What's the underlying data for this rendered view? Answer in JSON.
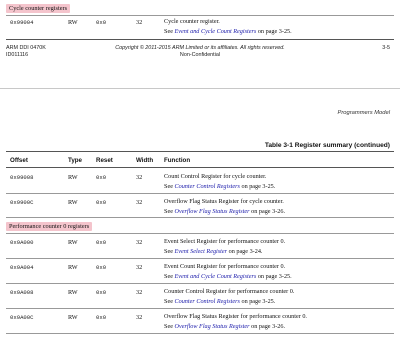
{
  "top_section": {
    "label": "Cycle counter registers",
    "row": {
      "offset": "0x99004",
      "type": "RW",
      "reset": "0x0",
      "width": "32",
      "line1": "Cycle counter register.",
      "see": "See ",
      "link": "Event and Cycle Count Registers",
      "page": " on page 3-25."
    }
  },
  "footer": {
    "doc_id": "ARM DDI 0470K",
    "doc_id2": "ID011116",
    "copyright": "Copyright © 2011-2015 ARM Limited or its affiliates. All rights reserved.",
    "confidential": "Non-Confidential",
    "page_no": "3-5"
  },
  "header": {
    "running_title": "Programmers Model"
  },
  "table": {
    "caption": "Table 3-1 Register summary (continued)",
    "columns": [
      "Offset",
      "Type",
      "Reset",
      "Width",
      "Function"
    ],
    "rows_a": [
      {
        "offset": "0x99008",
        "type": "RW",
        "reset": "0x0",
        "width": "32",
        "line1": "Count Control Register for cycle counter.",
        "see": "See ",
        "link": "Counter Control Registers",
        "page": " on page 3-25."
      },
      {
        "offset": "0x9900C",
        "type": "RW",
        "reset": "0x0",
        "width": "32",
        "line1": "Overflow Flag Status Register for cycle counter.",
        "see": "See ",
        "link": "Overflow Flag Status Register",
        "page": " on page 3-26."
      }
    ],
    "section_label": "Performance counter 0 registers",
    "rows_b": [
      {
        "offset": "0x9A000",
        "type": "RW",
        "reset": "0x0",
        "width": "32",
        "line1": "Event Select Register for performance counter 0.",
        "see": "See ",
        "link": "Event Select Register",
        "page": " on page 3-24."
      },
      {
        "offset": "0x9A004",
        "type": "RW",
        "reset": "0x0",
        "width": "32",
        "line1": "Event Count Register for performance counter 0.",
        "see": "See ",
        "link": "Event and Cycle Count Registers",
        "page": " on page 3-25."
      },
      {
        "offset": "0x9A008",
        "type": "RW",
        "reset": "0x0",
        "width": "32",
        "line1": "Counter Control Register for performance counter 0.",
        "see": "See ",
        "link": "Counter Control Registers",
        "page": " on page 3-25."
      },
      {
        "offset": "0x9A00C",
        "type": "RW",
        "reset": "0x0",
        "width": "32",
        "line1": "Overflow Flag Status Register for performance counter 0.",
        "see": "See ",
        "link": "Overflow Flag Status Register",
        "page": " on page 3-26."
      }
    ]
  }
}
